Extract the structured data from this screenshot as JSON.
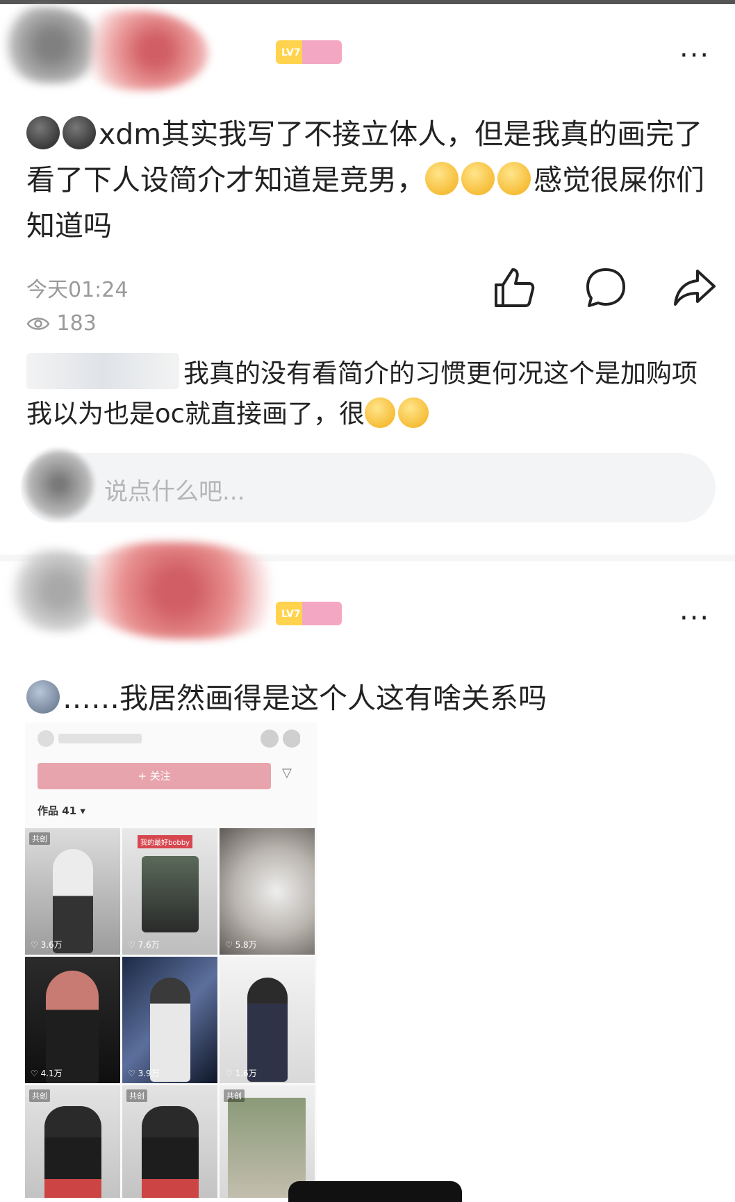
{
  "post1": {
    "badge_level": "LV7",
    "more_label": "···",
    "text_a": "xdm其实我写了不接立体人，但是我真的画完了看了下人设简介才知道是竞男，",
    "text_b": "感觉很屎你们知道吗",
    "time": "今天01:24",
    "views": "183"
  },
  "comment": {
    "text": "我真的没有看简介的习惯更何况这个是加购项我以为也是oc就直接画了，很"
  },
  "input": {
    "placeholder": "说点什么吧..."
  },
  "post2": {
    "badge_level": "LV7",
    "more_label": "···",
    "text": "……我居然画得是这个人这有啥关系吗"
  },
  "screenshot": {
    "follow_label": "+ 关注",
    "works_label": "作品 41 ▾",
    "tiles": [
      {
        "likes": "3.6万",
        "tag": "共创"
      },
      {
        "likes": "7.6万",
        "tag": "我的最好bobby"
      },
      {
        "likes": "5.8万",
        "tag": ""
      },
      {
        "likes": "4.1万",
        "tag": ""
      },
      {
        "likes": "3.9万",
        "tag": ""
      },
      {
        "likes": "1.6万",
        "tag": ""
      },
      {
        "likes": "",
        "tag": "共创"
      },
      {
        "likes": "",
        "tag": "共创"
      },
      {
        "likes": "",
        "tag": "共创"
      }
    ]
  }
}
